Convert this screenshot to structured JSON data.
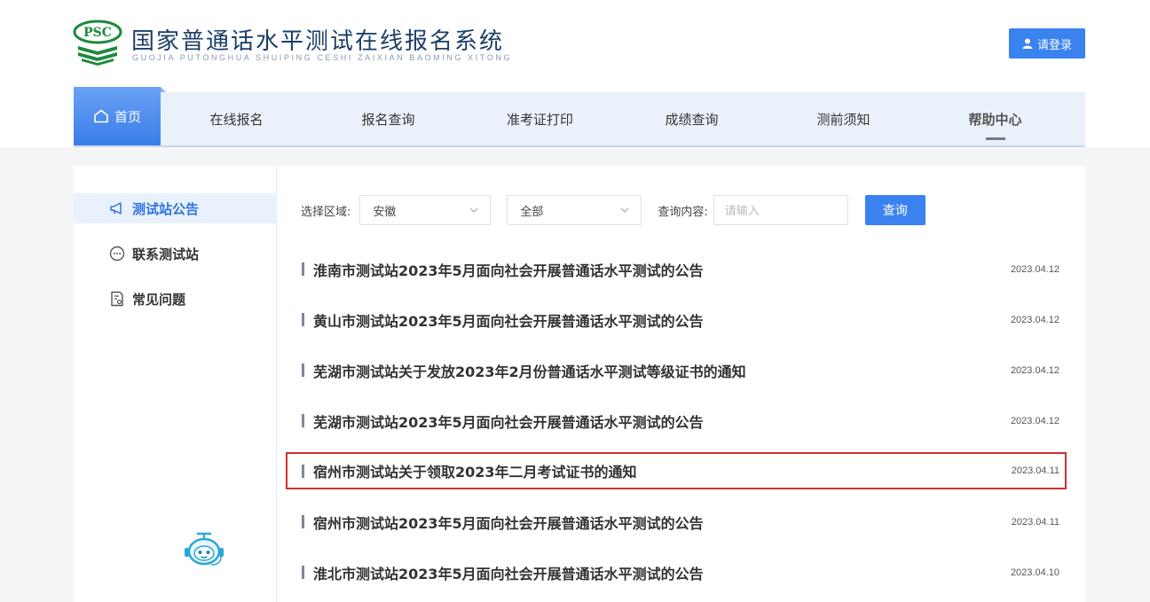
{
  "header": {
    "logo_badge": "PSC",
    "title": "国家普通话水平测试在线报名系统",
    "subtitle": "GUOJIA PUTONGHUA SHUIPING CESHI ZAIXIAN BAOMING XITONG",
    "login_label": "请登录",
    "accent_color": "#3a82f0"
  },
  "nav": {
    "items": [
      {
        "label": "首页",
        "icon": "home-icon"
      },
      {
        "label": "在线报名"
      },
      {
        "label": "报名查询"
      },
      {
        "label": "准考证打印"
      },
      {
        "label": "成绩查询"
      },
      {
        "label": "测前须知"
      },
      {
        "label": "帮助中心"
      }
    ],
    "active": "首页"
  },
  "sidebar": {
    "items": [
      {
        "label": "测试站公告",
        "icon": "megaphone-icon",
        "active": true
      },
      {
        "label": "联系测试站",
        "icon": "chat-bubble-icon",
        "active": false
      },
      {
        "label": "常见问题",
        "icon": "question-doc-icon",
        "active": false
      }
    ],
    "assistant_icon": "robot-assistant-icon"
  },
  "filters": {
    "region_label": "选择区域:",
    "region_value": "安徽",
    "scope_value": "全部",
    "query_label": "查询内容:",
    "query_placeholder": "请输入",
    "query_button": "查询"
  },
  "notices": [
    {
      "title": "淮南市测试站2023年5月面向社会开展普通话水平测试的公告",
      "date": "2023.04.12"
    },
    {
      "title": "黄山市测试站2023年5月面向社会开展普通话水平测试的公告",
      "date": "2023.04.12"
    },
    {
      "title": "芜湖市测试站关于发放2023年2月份普通话水平测试等级证书的通知",
      "date": "2023.04.12"
    },
    {
      "title": "芜湖市测试站2023年5月面向社会开展普通话水平测试的公告",
      "date": "2023.04.12"
    },
    {
      "title": "宿州市测试站关于领取2023年二月考试证书的通知",
      "date": "2023.04.11",
      "highlighted": true
    },
    {
      "title": "宿州市测试站2023年5月面向社会开展普通话水平测试的公告",
      "date": "2023.04.11"
    },
    {
      "title": "淮北市测试站2023年5月面向社会开展普通话水平测试的公告",
      "date": "2023.04.10"
    }
  ]
}
